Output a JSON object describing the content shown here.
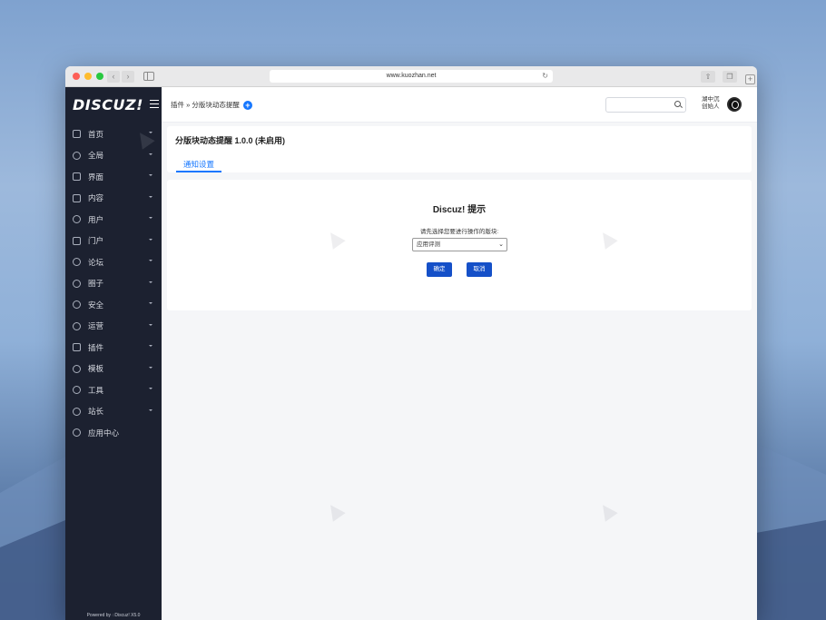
{
  "browser": {
    "url": "www.kuozhan.net"
  },
  "sidebar": {
    "logo": "DISCUZ!",
    "items": [
      {
        "label": "首页",
        "icon": "home-icon"
      },
      {
        "label": "全局",
        "icon": "globe-icon"
      },
      {
        "label": "界面",
        "icon": "layout-icon"
      },
      {
        "label": "内容",
        "icon": "document-icon"
      },
      {
        "label": "用户",
        "icon": "user-icon"
      },
      {
        "label": "门户",
        "icon": "portal-icon"
      },
      {
        "label": "论坛",
        "icon": "forum-icon"
      },
      {
        "label": "圈子",
        "icon": "group-icon"
      },
      {
        "label": "安全",
        "icon": "shield-icon"
      },
      {
        "label": "运营",
        "icon": "operation-icon"
      },
      {
        "label": "插件",
        "icon": "plugin-icon"
      },
      {
        "label": "模板",
        "icon": "template-icon"
      },
      {
        "label": "工具",
        "icon": "gear-icon"
      },
      {
        "label": "站长",
        "icon": "admin-icon"
      },
      {
        "label": "应用中心",
        "icon": "app-center-icon"
      }
    ],
    "powered": "Powered by ◌Discuz! X5.0"
  },
  "topbar": {
    "breadcrumb": "插件 » 分版块动态提醒",
    "user_name": "湖中沉",
    "user_role": "创始人"
  },
  "header": {
    "title": "分版块动态提醒 1.0.0 (未启用)",
    "tab": "通知设置"
  },
  "dialog": {
    "title": "Discuz! 提示",
    "prompt": "请先选择您要进行操作的版块:",
    "select_value": "应用评测",
    "ok_label": "确定",
    "cancel_label": "取消"
  },
  "colors": {
    "accent": "#1677ff",
    "button": "#1550c8",
    "sidebar_bg": "#1c2130"
  }
}
